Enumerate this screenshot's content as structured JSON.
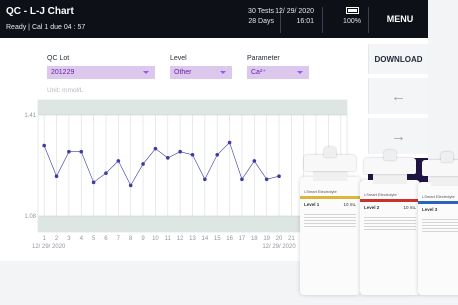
{
  "header": {
    "title": "QC - L-J Chart",
    "status": "Ready | Cal 1  due 04 : 57",
    "tests": "30 Tests",
    "days": "28 Days",
    "date": "12/ 29/ 2020",
    "time": "16:01",
    "battery": "100%",
    "menu_label": "MENU"
  },
  "selectors": {
    "qc_lot_label": "QC Lot",
    "qc_lot_value": "201229",
    "level_label": "Level",
    "level_value": "Other",
    "parameter_label": "Parameter",
    "parameter_value": "Ca²⁺"
  },
  "unit_label": "Unit: mmol/L",
  "buttons": {
    "download": "DOWNLOAD",
    "prev": "←",
    "next": "→"
  },
  "chart_data": {
    "type": "line",
    "y_ticks": [
      "1.41",
      "1.08"
    ],
    "x": [
      "1",
      "2",
      "3",
      "4",
      "5",
      "6",
      "7",
      "8",
      "9",
      "10",
      "11",
      "12",
      "13",
      "14",
      "15",
      "16",
      "17",
      "18",
      "19",
      "20",
      "21",
      "22",
      "23",
      "24",
      "25"
    ],
    "x_start_date": "12/ 29/ 2020",
    "x_end_date": "12/ 29/ 2020",
    "ylim": [
      1.08,
      1.41
    ],
    "series": [
      {
        "values": [
          1.31,
          1.21,
          1.29,
          1.29,
          1.19,
          1.22,
          1.26,
          1.18,
          1.25,
          1.3,
          1.27,
          1.29,
          1.28,
          1.2,
          1.28,
          1.32,
          1.2,
          1.26,
          1.2,
          1.21
        ],
        "color": "#3d3ba5"
      }
    ],
    "grid": true,
    "band_color": "#dde6e3"
  },
  "bottles": [
    {
      "brand": "i-Smart Electrolyte",
      "level": "Level 1",
      "volume": "10 mL",
      "stripe_color": "#d9b73a"
    },
    {
      "brand": "i-Smart Electrolyte",
      "level": "Level 2",
      "volume": "10 mL",
      "stripe_color": "#c8342c"
    },
    {
      "brand": "i-Smart Electrolyte",
      "level": "Level 3",
      "volume": "10 mL",
      "stripe_color": "#2c62b8"
    }
  ]
}
